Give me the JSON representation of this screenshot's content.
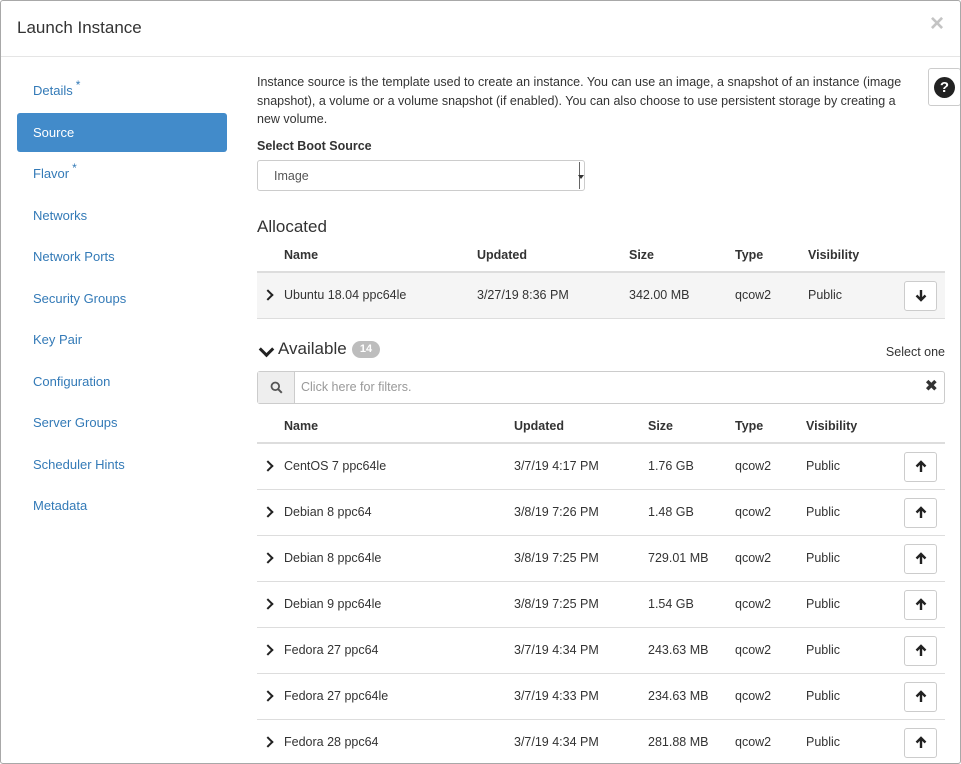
{
  "modal": {
    "title": "Launch Instance",
    "close_glyph": "×"
  },
  "sidebar": {
    "items": [
      {
        "label": "Details",
        "required": "*"
      },
      {
        "label": "Source",
        "required": ""
      },
      {
        "label": "Flavor",
        "required": "*"
      },
      {
        "label": "Networks",
        "required": ""
      },
      {
        "label": "Network Ports",
        "required": ""
      },
      {
        "label": "Security Groups",
        "required": ""
      },
      {
        "label": "Key Pair",
        "required": ""
      },
      {
        "label": "Configuration",
        "required": ""
      },
      {
        "label": "Server Groups",
        "required": ""
      },
      {
        "label": "Scheduler Hints",
        "required": ""
      },
      {
        "label": "Metadata",
        "required": ""
      }
    ],
    "active_index": 1
  },
  "main": {
    "help_glyph": "?",
    "intro": "Instance source is the template used to create an instance. You can use an image, a snapshot of an instance (image snapshot), a volume or a volume snapshot (if enabled). You can also choose to use persistent storage by creating a new volume.",
    "boot_source_label": "Select Boot Source",
    "boot_source_value": "Image",
    "allocated": {
      "title": "Allocated",
      "columns": [
        "Name",
        "Updated",
        "Size",
        "Type",
        "Visibility"
      ],
      "rows": [
        {
          "name": "Ubuntu 18.04 ppc64le",
          "updated": "3/27/19 8:36 PM",
          "size": "342.00 MB",
          "type": "qcow2",
          "visibility": "Public"
        }
      ]
    },
    "available": {
      "title": "Available",
      "count": "14",
      "select_hint": "Select one",
      "filter_placeholder": "Click here for filters.",
      "columns": [
        "Name",
        "Updated",
        "Size",
        "Type",
        "Visibility"
      ],
      "rows": [
        {
          "name": "CentOS 7 ppc64le",
          "updated": "3/7/19 4:17 PM",
          "size": "1.76 GB",
          "type": "qcow2",
          "visibility": "Public"
        },
        {
          "name": "Debian 8 ppc64",
          "updated": "3/8/19 7:26 PM",
          "size": "1.48 GB",
          "type": "qcow2",
          "visibility": "Public"
        },
        {
          "name": "Debian 8 ppc64le",
          "updated": "3/8/19 7:25 PM",
          "size": "729.01 MB",
          "type": "qcow2",
          "visibility": "Public"
        },
        {
          "name": "Debian 9 ppc64le",
          "updated": "3/8/19 7:25 PM",
          "size": "1.54 GB",
          "type": "qcow2",
          "visibility": "Public"
        },
        {
          "name": "Fedora 27 ppc64",
          "updated": "3/7/19 4:34 PM",
          "size": "243.63 MB",
          "type": "qcow2",
          "visibility": "Public"
        },
        {
          "name": "Fedora 27 ppc64le",
          "updated": "3/7/19 4:33 PM",
          "size": "234.63 MB",
          "type": "qcow2",
          "visibility": "Public"
        },
        {
          "name": "Fedora 28 ppc64",
          "updated": "3/7/19 4:34 PM",
          "size": "281.88 MB",
          "type": "qcow2",
          "visibility": "Public"
        }
      ]
    }
  },
  "colors": {
    "accent": "#428bca",
    "link": "#337ab7",
    "badge": "#bdbdbd"
  }
}
